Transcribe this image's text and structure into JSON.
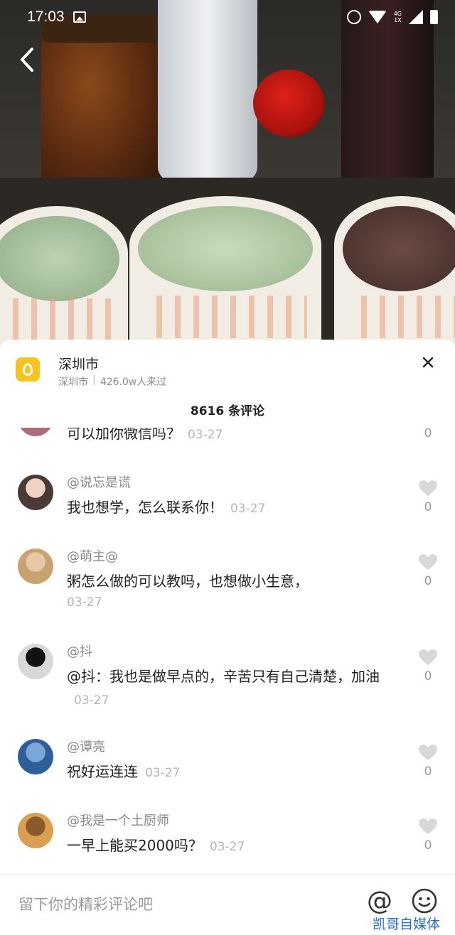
{
  "status_bar": {
    "time": "17:03",
    "network": "4G",
    "network_sub": "1X",
    "icons": [
      "image-icon",
      "alarm-icon",
      "wifi-icon",
      "signal-icon",
      "battery-icon"
    ]
  },
  "location": {
    "name": "深圳市",
    "city": "深圳市",
    "separator": "|",
    "visitors": "426.0w人来过"
  },
  "comments_header": "8616 条评论",
  "comments": [
    {
      "author": "",
      "text": "可以加你微信吗？",
      "date": "03-27",
      "likes": "0",
      "avatar_colors": [
        "#d9c7b8",
        "#b06a7a"
      ]
    },
    {
      "author": "@说忘是谎",
      "text": "我也想学，怎么联系你！",
      "date": "03-27",
      "likes": "0",
      "avatar_colors": [
        "#f0d3c2",
        "#4a3a35"
      ]
    },
    {
      "author": "@萌主@",
      "text": "粥怎么做的可以教吗，也想做小生意，",
      "date": "03-27",
      "likes": "0",
      "avatar_colors": [
        "#e6c7a8",
        "#c9a36f"
      ]
    },
    {
      "author": "@抖",
      "text": "@抖：我也是做早点的，辛苦只有自己清楚，加油",
      "date": "03-27",
      "likes": "0",
      "avatar_colors": [
        "#111111",
        "#d8d8d8"
      ]
    },
    {
      "author": "@谭亮",
      "text": "祝好运连连",
      "date": "03-27",
      "likes": "0",
      "avatar_colors": [
        "#7aa7d8",
        "#2f5f9a"
      ]
    },
    {
      "author": "@我是一个土厨师",
      "text": "一早上能买2000吗？",
      "date": "03-27",
      "likes": "0",
      "avatar_colors": [
        "#8a5a2a",
        "#d8a050"
      ]
    }
  ],
  "input": {
    "placeholder": "留下你的精彩评论吧"
  },
  "at_symbol": "@",
  "watermark": "凯哥自媒体",
  "colors": {
    "accent_yellow": "#f6c320",
    "watermark_blue": "#2a6fd0"
  }
}
